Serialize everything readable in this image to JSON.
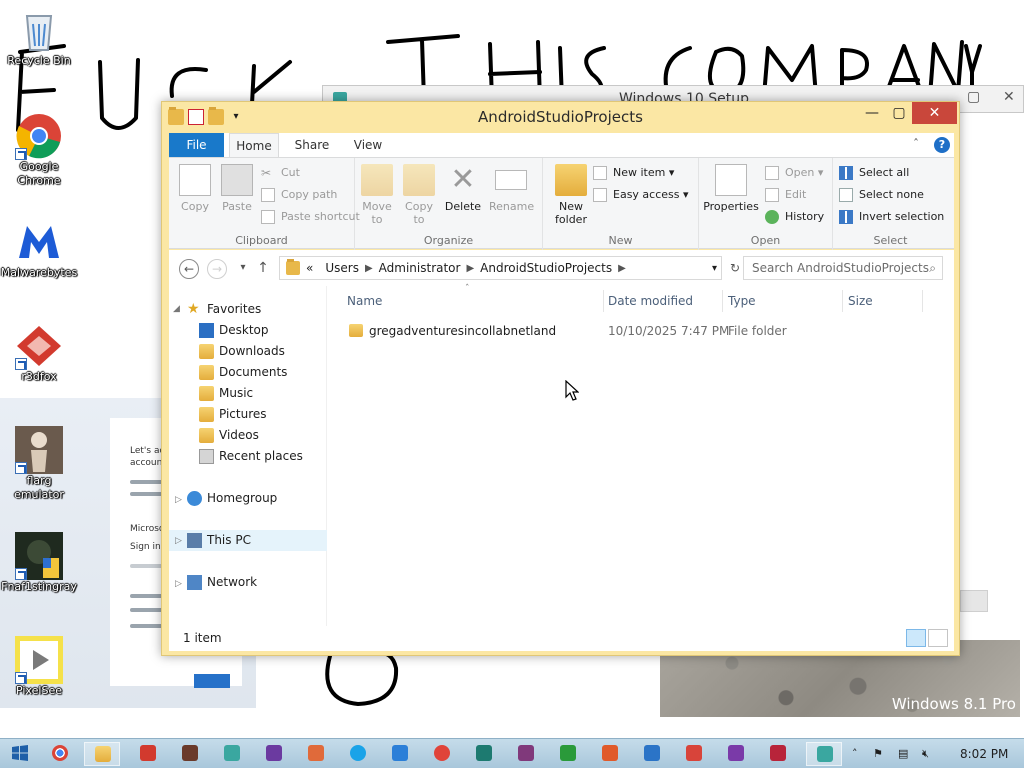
{
  "desktop": {
    "icons": [
      {
        "label": "Recycle Bin"
      },
      {
        "label": "Google Chrome"
      },
      {
        "label": "Malwarebytes"
      },
      {
        "label": "r3dfox"
      },
      {
        "label": "flarg emulator"
      },
      {
        "label": "Fnaf1stingray"
      },
      {
        "label": "PixelSee"
      }
    ],
    "scrawl_text": "FUCK THIS COMPANY",
    "background_window_title": "Windows 10 Setup",
    "watermark": "Windows 8.1 Pro"
  },
  "window": {
    "title": "AndroidStudioProjects",
    "minimize_label": "—",
    "maximize_label": "▢",
    "close_label": "✕",
    "tabs": {
      "file": "File",
      "home": "Home",
      "share": "Share",
      "view": "View"
    },
    "help_label": "?"
  },
  "ribbon": {
    "clipboard": {
      "copy": "Copy",
      "paste": "Paste",
      "cut": "Cut",
      "copy_path": "Copy path",
      "paste_shortcut": "Paste shortcut",
      "group": "Clipboard"
    },
    "organize": {
      "move_to_1": "Move",
      "move_to_2": "to",
      "copy_to_1": "Copy",
      "copy_to_2": "to",
      "delete": "Delete",
      "rename": "Rename",
      "group": "Organize"
    },
    "new": {
      "new_folder_1": "New",
      "new_folder_2": "folder",
      "new_item": "New item",
      "easy_access": "Easy access",
      "group": "New"
    },
    "open": {
      "properties": "Properties",
      "open": "Open",
      "edit": "Edit",
      "history": "History",
      "group": "Open"
    },
    "select": {
      "select_all": "Select all",
      "select_none": "Select none",
      "invert_selection": "Invert selection",
      "group": "Select"
    }
  },
  "address": {
    "overflow": "«",
    "crumbs": [
      "Users",
      "Administrator",
      "AndroidStudioProjects"
    ],
    "search_placeholder": "Search AndroidStudioProjects"
  },
  "navpane": {
    "favorites": "Favorites",
    "favorites_items": [
      "Desktop",
      "Downloads",
      "Documents",
      "Music",
      "Pictures",
      "Videos",
      "Recent places"
    ],
    "homegroup": "Homegroup",
    "this_pc": "This PC",
    "network": "Network"
  },
  "filelist": {
    "columns": {
      "name": "Name",
      "date": "Date modified",
      "type": "Type",
      "size": "Size"
    },
    "rows": [
      {
        "name": "gregadventuresincollabnetland",
        "date": "10/10/2025 7:47 PM",
        "type": "File folder",
        "size": ""
      }
    ]
  },
  "status": {
    "count": "1 item"
  },
  "taskbar": {
    "time": "8:02 PM"
  },
  "colors": {
    "window_frame": "#fbe7a4",
    "file_tab": "#1979ca",
    "close_button": "#c9473b",
    "taskbar": "#b7d2e3"
  }
}
